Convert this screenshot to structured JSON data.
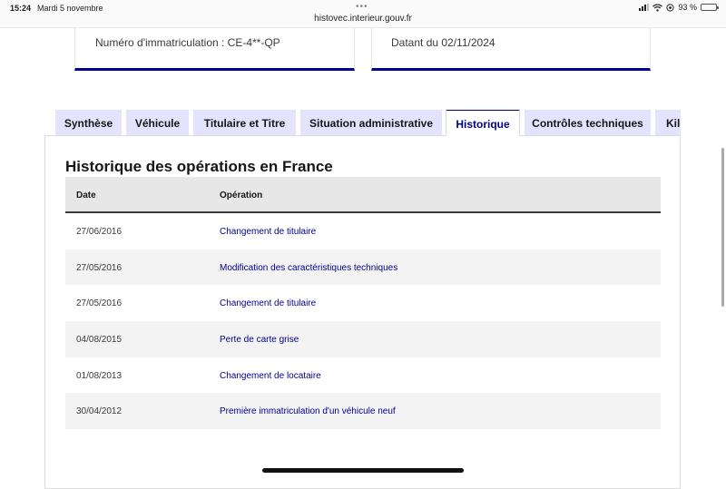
{
  "status_bar": {
    "time": "15:24",
    "date": "Mardi 5 novembre",
    "url": "histovec.interieur.gouv.fr",
    "battery": "93 %",
    "battery_level": 0.93
  },
  "cards": {
    "registration": "Numéro d'immatriculation : CE-4**-QP",
    "dated": "Datant du 02/11/2024"
  },
  "tabs": [
    {
      "label": "Synthèse"
    },
    {
      "label": "Véhicule"
    },
    {
      "label": "Titulaire et Titre"
    },
    {
      "label": "Situation administrative"
    },
    {
      "label": "Historique"
    },
    {
      "label": "Contrôles techniques"
    },
    {
      "label": "Kilométrage"
    }
  ],
  "active_tab": "Historique",
  "history": {
    "title": "Historique des opérations en France",
    "columns": {
      "date": "Date",
      "operation": "Opération"
    },
    "rows": [
      {
        "date": "27/06/2016",
        "operation": "Changement de titulaire"
      },
      {
        "date": "27/05/2016",
        "operation": "Modification des caractéristiques techniques"
      },
      {
        "date": "27/05/2016",
        "operation": "Changement de titulaire"
      },
      {
        "date": "04/08/2015",
        "operation": "Perte de carte grise"
      },
      {
        "date": "01/08/2013",
        "operation": "Changement de locataire"
      },
      {
        "date": "30/04/2012",
        "operation": "Première immatriculation d'un véhicule neuf"
      }
    ]
  },
  "colors": {
    "accent": "#000091",
    "tab_bg": "#e3e3fd",
    "row_alt": "#f3f3f3",
    "header_bg": "#e7e7e7"
  }
}
